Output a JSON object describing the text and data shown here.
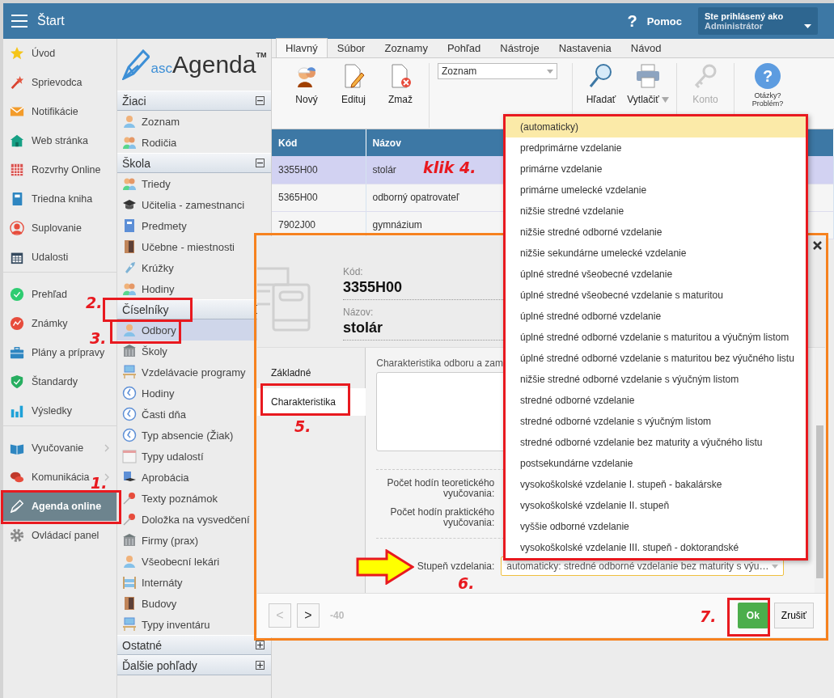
{
  "topbar": {
    "title": "Štart",
    "help_glyph": "?",
    "help_label": "Pomoc",
    "user_label": "Ste prihlásený ako",
    "user_name": "Administrátor"
  },
  "nav": [
    {
      "items": [
        {
          "label": "Úvod",
          "selected": false,
          "submenu": false
        },
        {
          "label": "Sprievodca",
          "selected": false,
          "submenu": false
        },
        {
          "label": "Notifikácie",
          "selected": false,
          "submenu": false
        },
        {
          "label": "Web stránka",
          "selected": false,
          "submenu": false
        },
        {
          "label": "Rozvrhy Online",
          "selected": false,
          "submenu": false
        },
        {
          "label": "Triedna kniha",
          "selected": false,
          "submenu": false
        },
        {
          "label": "Suplovanie",
          "selected": false,
          "submenu": false
        },
        {
          "label": "Udalosti",
          "selected": false,
          "submenu": false
        }
      ]
    },
    {
      "items": [
        {
          "label": "Prehľad",
          "selected": false,
          "submenu": false
        },
        {
          "label": "Známky",
          "selected": false,
          "submenu": false
        },
        {
          "label": "Plány a prípravy",
          "selected": false,
          "submenu": false
        },
        {
          "label": "Štandardy",
          "selected": false,
          "submenu": false
        },
        {
          "label": "Výsledky",
          "selected": false,
          "submenu": false
        }
      ]
    },
    {
      "items": [
        {
          "label": "Vyučovanie",
          "selected": false,
          "submenu": true
        },
        {
          "label": "Komunikácia",
          "selected": false,
          "submenu": true
        },
        {
          "label": "Agenda online",
          "selected": true,
          "submenu": false
        },
        {
          "label": "Ovládací panel",
          "selected": false,
          "submenu": false
        }
      ]
    }
  ],
  "logo": {
    "prefix": "asc",
    "name": "Agenda",
    "mark": "TM"
  },
  "sections": [
    {
      "title": "Žiaci",
      "expanded": true,
      "items": [
        {
          "label": "Zoznam",
          "selected": false
        },
        {
          "label": "Rodičia",
          "selected": false
        }
      ]
    },
    {
      "title": "Škola",
      "expanded": true,
      "items": [
        {
          "label": "Triedy",
          "selected": false
        },
        {
          "label": "Učitelia - zamestnanci",
          "selected": false
        },
        {
          "label": "Predmety",
          "selected": false
        },
        {
          "label": "Učebne - miestnosti",
          "selected": false
        },
        {
          "label": "Krúžky",
          "selected": false
        },
        {
          "label": "Hodiny",
          "selected": false
        }
      ]
    },
    {
      "title": "Číselníky",
      "expanded": true,
      "items": [
        {
          "label": "Odbory",
          "selected": true
        },
        {
          "label": "Školy",
          "selected": false
        },
        {
          "label": "Vzdelávacie programy",
          "selected": false
        },
        {
          "label": "Hodiny",
          "selected": false
        },
        {
          "label": "Časti dňa",
          "selected": false
        },
        {
          "label": "Typ absencie (Žiak)",
          "selected": false
        },
        {
          "label": "Typy udalostí",
          "selected": false
        },
        {
          "label": "Aprobácia",
          "selected": false
        },
        {
          "label": "Texty poznámok",
          "selected": false
        },
        {
          "label": "Doložka na vysvedčení",
          "selected": false
        },
        {
          "label": "Firmy (prax)",
          "selected": false
        },
        {
          "label": "Všeobecní lekári",
          "selected": false
        },
        {
          "label": "Internáty",
          "selected": false
        },
        {
          "label": "Budovy",
          "selected": false
        },
        {
          "label": "Typy inventáru",
          "selected": false
        }
      ]
    },
    {
      "title": "Ostatné",
      "expanded": false
    },
    {
      "title": "Ďalšie pohľady",
      "expanded": false
    }
  ],
  "ribbon_tabs": [
    {
      "label": "Hlavný",
      "selected": true
    },
    {
      "label": "Súbor",
      "selected": false
    },
    {
      "label": "Zoznamy",
      "selected": false
    },
    {
      "label": "Pohľad",
      "selected": false
    },
    {
      "label": "Nástroje",
      "selected": false
    },
    {
      "label": "Nastavenia",
      "selected": false
    },
    {
      "label": "Návod",
      "selected": false
    }
  ],
  "toolbar": [
    {
      "kind": "button",
      "label": "Nový",
      "disabled": false
    },
    {
      "kind": "button",
      "label": "Edituj",
      "disabled": false
    },
    {
      "kind": "button",
      "label": "Zmaž",
      "disabled": false
    },
    {
      "kind": "select",
      "value": "Zoznam"
    },
    {
      "kind": "button",
      "label": "Hľadať",
      "disabled": false
    },
    {
      "kind": "button",
      "label": "Vytlačiť",
      "disabled": false,
      "dropdown": true
    },
    {
      "kind": "button",
      "label": "Konto",
      "disabled": true
    },
    {
      "kind": "help",
      "glyph": "?",
      "label": "Otázky? Problém?"
    }
  ],
  "table": {
    "columns": [
      "Kód",
      "Názov"
    ],
    "rows": [
      {
        "cells": [
          "3355H00",
          "stolár"
        ],
        "selected": true
      },
      {
        "cells": [
          "5365H00",
          "odborný opatrovateľ"
        ],
        "selected": false
      },
      {
        "cells": [
          "7902J00",
          "gymnázium"
        ],
        "selected": false
      }
    ]
  },
  "dialog": {
    "code_label": "Kód:",
    "code": "3355H00",
    "name_label": "Názov:",
    "name": "stolár",
    "tabs": [
      {
        "label": "Základné",
        "selected": false
      },
      {
        "label": "Charakteristika",
        "selected": true
      }
    ],
    "text_label": "Charakteristika odboru a zam",
    "fields": [
      {
        "label": "Počet hodín teoretického vyučovania:"
      },
      {
        "label": "Počet hodín praktického vyučovania:"
      }
    ],
    "level_label": "Stupeň vzdelania:",
    "level_value": "automaticky: stredné odborné vzdelanie bez maturity s výu…",
    "prev": {
      "label": "<",
      "disabled": true
    },
    "next": {
      "label": ">",
      "disabled": false
    },
    "counter": "-40",
    "ok": "Ok",
    "cancel": "Zrušiť"
  },
  "dropdown": [
    {
      "label": "(automaticky)",
      "selected": true
    },
    {
      "label": "predprimárne vzdelanie",
      "selected": false
    },
    {
      "label": "primárne vzdelanie",
      "selected": false
    },
    {
      "label": "primárne umelecké vzdelanie",
      "selected": false
    },
    {
      "label": "nižšie stredné vzdelanie",
      "selected": false
    },
    {
      "label": "nižšie stredné odborné vzdelanie",
      "selected": false
    },
    {
      "label": "nižšie sekundárne umelecké vzdelanie",
      "selected": false
    },
    {
      "label": "úplné stredné všeobecné vzdelanie",
      "selected": false
    },
    {
      "label": "úplné stredné všeobecné vzdelanie s maturitou",
      "selected": false
    },
    {
      "label": "úplné stredné odborné vzdelanie",
      "selected": false
    },
    {
      "label": "úplné stredné odborné vzdelanie s maturitou a výučným listom",
      "selected": false
    },
    {
      "label": "úplné stredné odborné vzdelanie s maturitou bez výučného listu",
      "selected": false
    },
    {
      "label": "nižšie stredné odborné vzdelanie s výučným listom",
      "selected": false
    },
    {
      "label": "stredné odborné vzdelanie",
      "selected": false
    },
    {
      "label": "stredné odborné vzdelanie s výučným listom",
      "selected": false
    },
    {
      "label": "stredné odborné vzdelanie bez maturity a výučného listu",
      "selected": false
    },
    {
      "label": "postsekundárne vzdelanie",
      "selected": false
    },
    {
      "label": "vysokoškolské vzdelanie I. stupeň - bakalárske",
      "selected": false
    },
    {
      "label": "vysokoškolské vzdelanie II. stupeň",
      "selected": false
    },
    {
      "label": "vyššie odborné vzdelanie",
      "selected": false
    },
    {
      "label": "vysokoškolské vzdelanie III. stupeň - doktorandské",
      "selected": false
    }
  ],
  "annotations": [
    "klik 4.",
    "2.",
    "3.",
    "5.",
    "1.",
    "6.",
    "7."
  ]
}
